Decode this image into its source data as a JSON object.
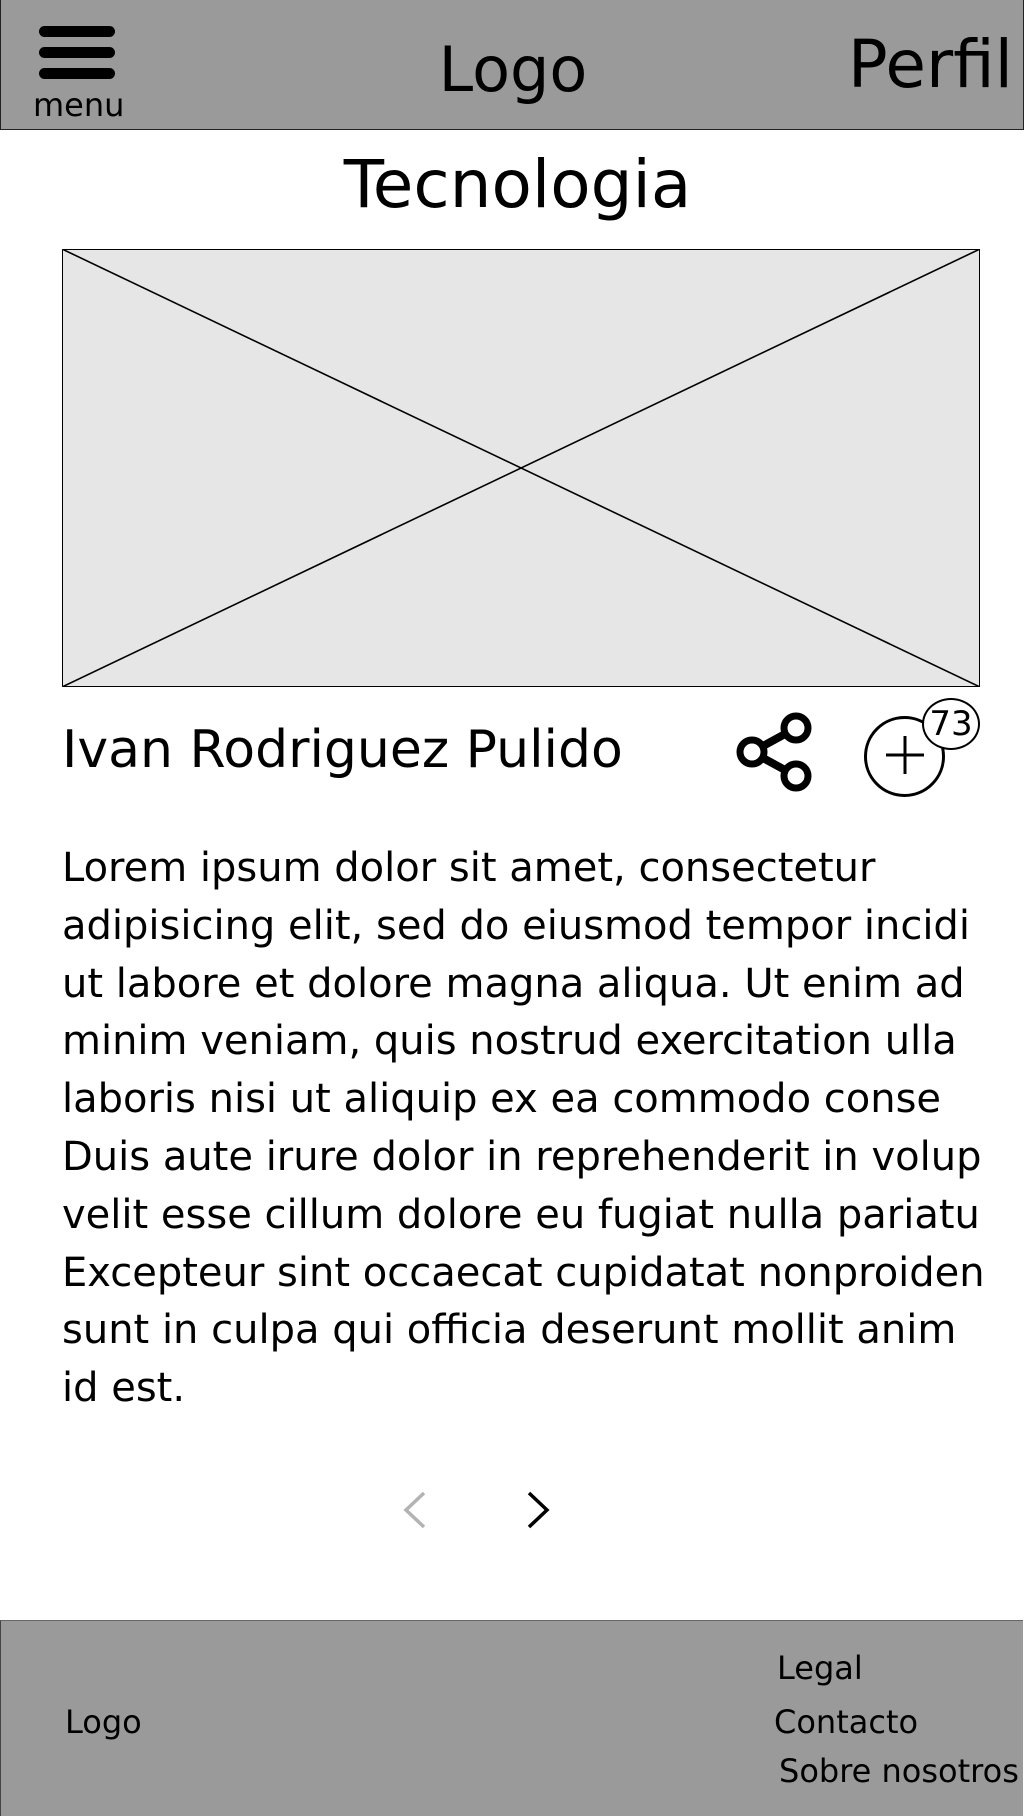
{
  "header": {
    "menu_icon": "hamburger-icon",
    "menu_label": "menu",
    "logo": "Logo",
    "profile_label": "Perfil"
  },
  "page": {
    "title": "Tecnologia"
  },
  "hero_image": {
    "icon": "image-placeholder-icon"
  },
  "article": {
    "author": "Ivan Rodriguez Pulido",
    "share_icon": "share-icon",
    "add_icon": "plus-circle-icon",
    "add_count": "73",
    "body_lines": [
      "Lorem ipsum dolor sit amet, consectetur",
      "adipisicing elit, sed do eiusmod tempor incidi",
      "ut labore et dolore magna aliqua. Ut enim ad",
      "minim veniam, quis nostrud exercitation ulla",
      "laboris  nisi ut aliquip ex ea commodo conse",
      "Duis aute irure dolor in reprehenderit in volup",
      "velit esse  cillum dolore eu fugiat nulla pariatu",
      "Excepteur sint occaecat cupidatat nonproiden",
      "sunt in culpa qui officia deserunt mollit anim",
      "id est."
    ]
  },
  "pagination": {
    "prev_icon": "chevron-left-icon",
    "next_icon": "chevron-right-icon"
  },
  "footer": {
    "logo": "Logo",
    "links": [
      "Legal",
      "Contacto",
      "Sobre nosotros"
    ]
  },
  "colors": {
    "header_bg": "#9a9a9a",
    "footer_bg": "#9a9a9a",
    "image_placeholder_bg": "#e6e6e6",
    "disabled_chevron": "#b3b3b3"
  }
}
